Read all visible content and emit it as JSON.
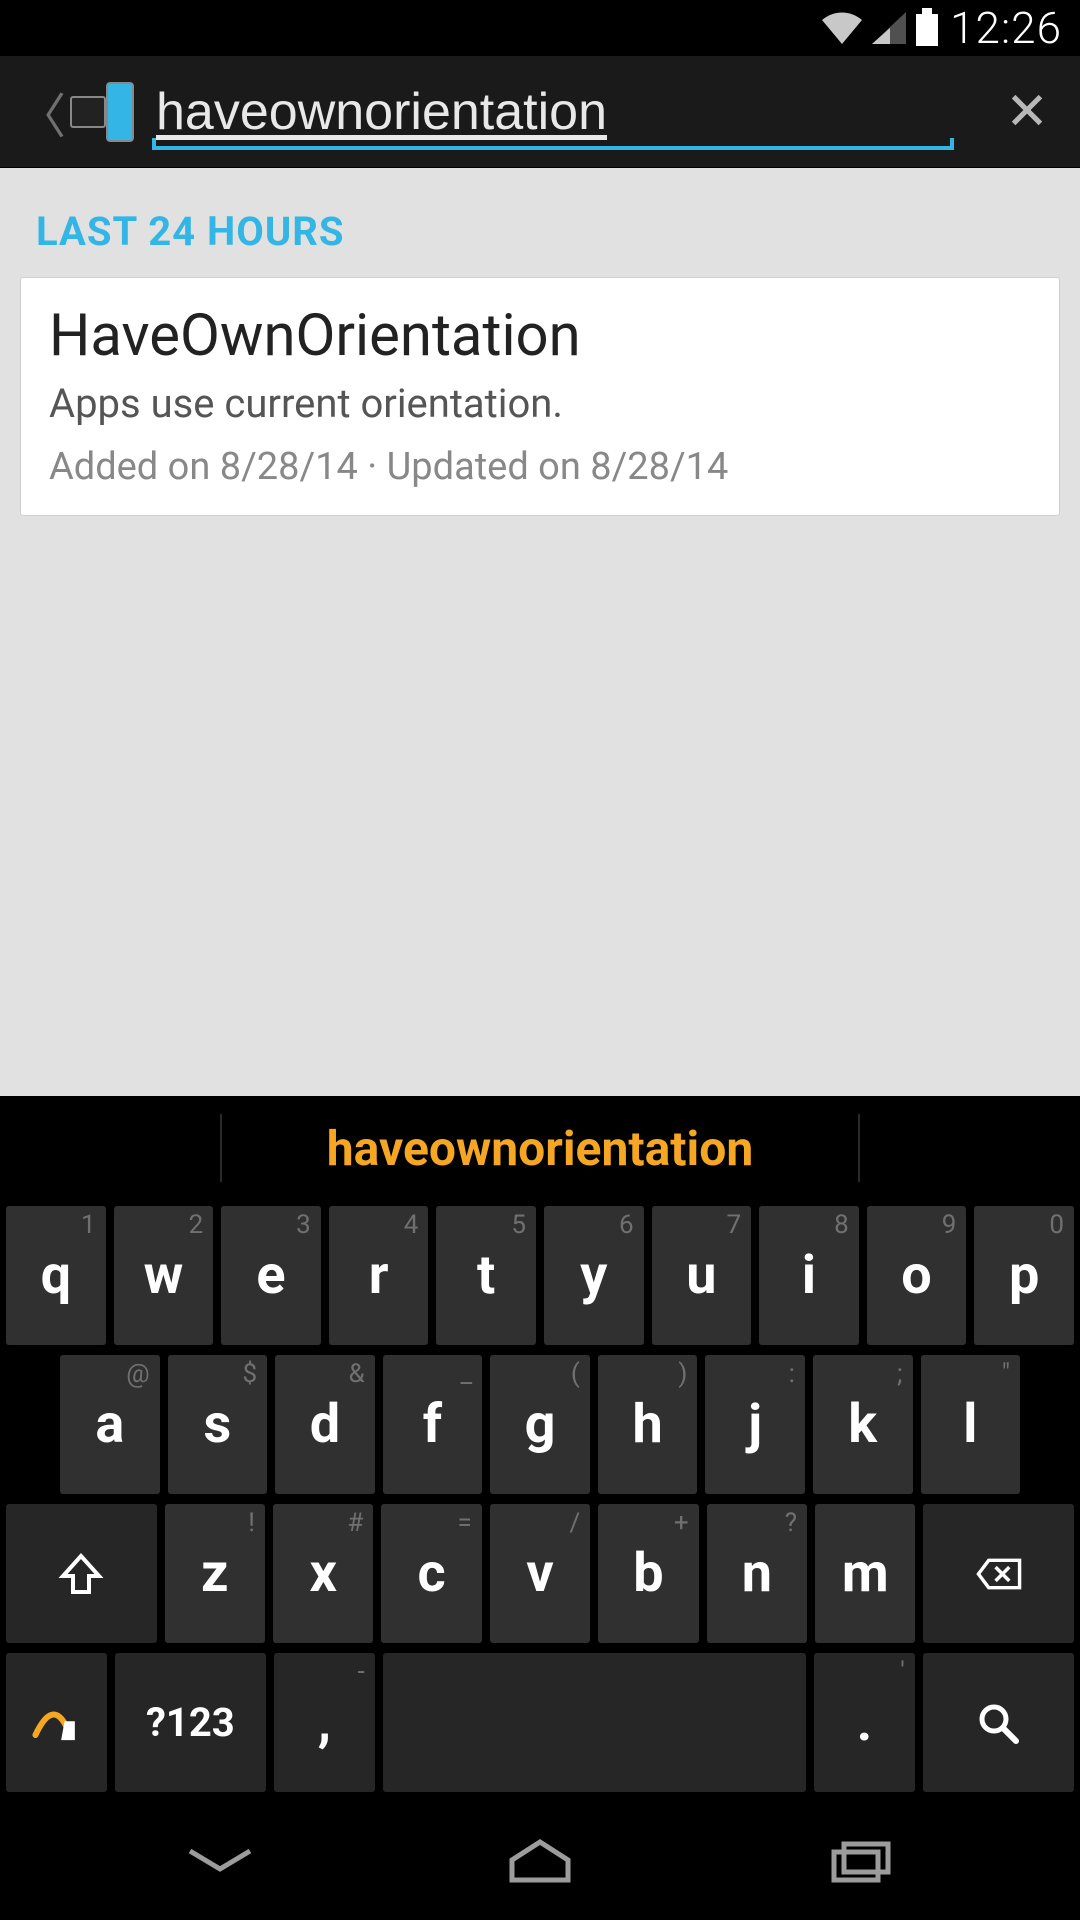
{
  "status": {
    "time": "12:26"
  },
  "search": {
    "value": "haveownorientation"
  },
  "section_label": "LAST 24 HOURS",
  "result": {
    "title": "HaveOwnOrientation",
    "subtitle": "Apps use current orientation.",
    "meta": "Added on 8/28/14 · Updated on 8/28/14"
  },
  "keyboard": {
    "suggestion": "haveownorientation",
    "row1": [
      {
        "k": "q",
        "a": "1"
      },
      {
        "k": "w",
        "a": "2"
      },
      {
        "k": "e",
        "a": "3"
      },
      {
        "k": "r",
        "a": "4"
      },
      {
        "k": "t",
        "a": "5"
      },
      {
        "k": "y",
        "a": "6"
      },
      {
        "k": "u",
        "a": "7"
      },
      {
        "k": "i",
        "a": "8"
      },
      {
        "k": "o",
        "a": "9"
      },
      {
        "k": "p",
        "a": "0"
      }
    ],
    "row2": [
      {
        "k": "a",
        "a": "@"
      },
      {
        "k": "s",
        "a": "$"
      },
      {
        "k": "d",
        "a": "&"
      },
      {
        "k": "f",
        "a": "_"
      },
      {
        "k": "g",
        "a": "("
      },
      {
        "k": "h",
        "a": ")"
      },
      {
        "k": "j",
        "a": ":"
      },
      {
        "k": "k",
        "a": ";"
      },
      {
        "k": "l",
        "a": "\""
      }
    ],
    "row3": [
      {
        "k": "z",
        "a": "!"
      },
      {
        "k": "x",
        "a": "#"
      },
      {
        "k": "c",
        "a": "="
      },
      {
        "k": "v",
        "a": "/"
      },
      {
        "k": "b",
        "a": "+"
      },
      {
        "k": "n",
        "a": "?"
      },
      {
        "k": "m",
        "a": ""
      }
    ],
    "symkey": "?123",
    "comma": ",",
    "comma_alt": "-",
    "period": ".",
    "period_alt": "'"
  }
}
